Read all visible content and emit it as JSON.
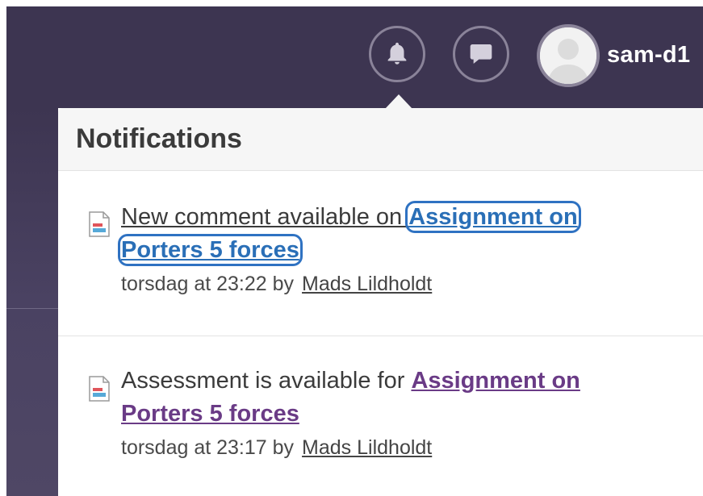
{
  "header": {
    "username": "sam-d1",
    "icons": [
      "bell-icon",
      "chat-bubble-icon",
      "avatar"
    ]
  },
  "notifications": {
    "title": "Notifications",
    "items": [
      {
        "text": "New comment available on ",
        "link": "Assignment on Porters 5 forces",
        "time": "torsdag at 23:22 by",
        "author": "Mads Lildholdt"
      },
      {
        "text": "Assessment is available for ",
        "link": "Assignment on Porters 5 forces",
        "time": "torsdag at 23:17 by",
        "author": "Mads Lildholdt"
      }
    ]
  },
  "colors": {
    "topbar": "#3d3551",
    "link_blue": "#2a6fb7",
    "link_purple": "#6a3b86"
  }
}
